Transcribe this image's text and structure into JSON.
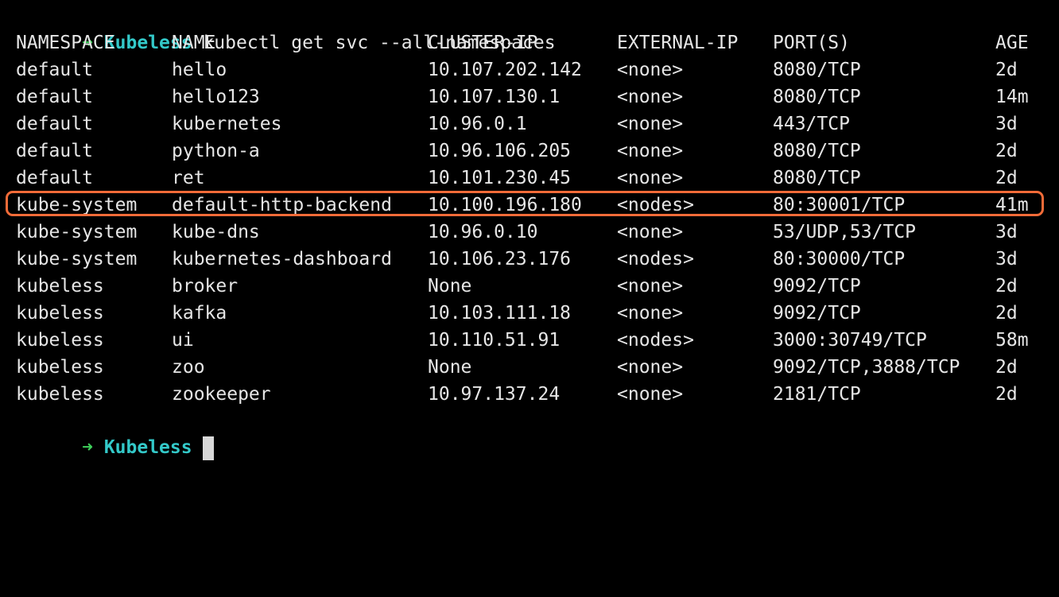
{
  "prompt": {
    "arrow": "➜",
    "directory": "Kubeless",
    "command": "kubectl get svc --all-namespaces"
  },
  "table": {
    "headers": [
      "NAMESPACE",
      "NAME",
      "CLUSTER-IP",
      "EXTERNAL-IP",
      "PORT(S)",
      "AGE"
    ],
    "rows": [
      [
        "default",
        "hello",
        "10.107.202.142",
        "<none>",
        "8080/TCP",
        "2d"
      ],
      [
        "default",
        "hello123",
        "10.107.130.1",
        "<none>",
        "8080/TCP",
        "14m"
      ],
      [
        "default",
        "kubernetes",
        "10.96.0.1",
        "<none>",
        "443/TCP",
        "3d"
      ],
      [
        "default",
        "python-a",
        "10.96.106.205",
        "<none>",
        "8080/TCP",
        "2d"
      ],
      [
        "default",
        "ret",
        "10.101.230.45",
        "<none>",
        "8080/TCP",
        "2d"
      ],
      [
        "kube-system",
        "default-http-backend",
        "10.100.196.180",
        "<nodes>",
        "80:30001/TCP",
        "41m"
      ],
      [
        "kube-system",
        "kube-dns",
        "10.96.0.10",
        "<none>",
        "53/UDP,53/TCP",
        "3d"
      ],
      [
        "kube-system",
        "kubernetes-dashboard",
        "10.106.23.176",
        "<nodes>",
        "80:30000/TCP",
        "3d"
      ],
      [
        "kubeless",
        "broker",
        "None",
        "<none>",
        "9092/TCP",
        "2d"
      ],
      [
        "kubeless",
        "kafka",
        "10.103.111.18",
        "<none>",
        "9092/TCP",
        "2d"
      ],
      [
        "kubeless",
        "ui",
        "10.110.51.91",
        "<nodes>",
        "3000:30749/TCP",
        "58m"
      ],
      [
        "kubeless",
        "zoo",
        "None",
        "<none>",
        "9092/TCP,3888/TCP",
        "2d"
      ],
      [
        "kubeless",
        "zookeeper",
        "10.97.137.24",
        "<none>",
        "2181/TCP",
        "2d"
      ]
    ]
  },
  "final_prompt": {
    "arrow": "➜",
    "directory": "Kubeless"
  },
  "colors": {
    "background": "#000000",
    "text": "#e6e6e6",
    "arrow": "#3ecf5a",
    "directory": "#33c9c9",
    "highlight": "#f26b38"
  }
}
